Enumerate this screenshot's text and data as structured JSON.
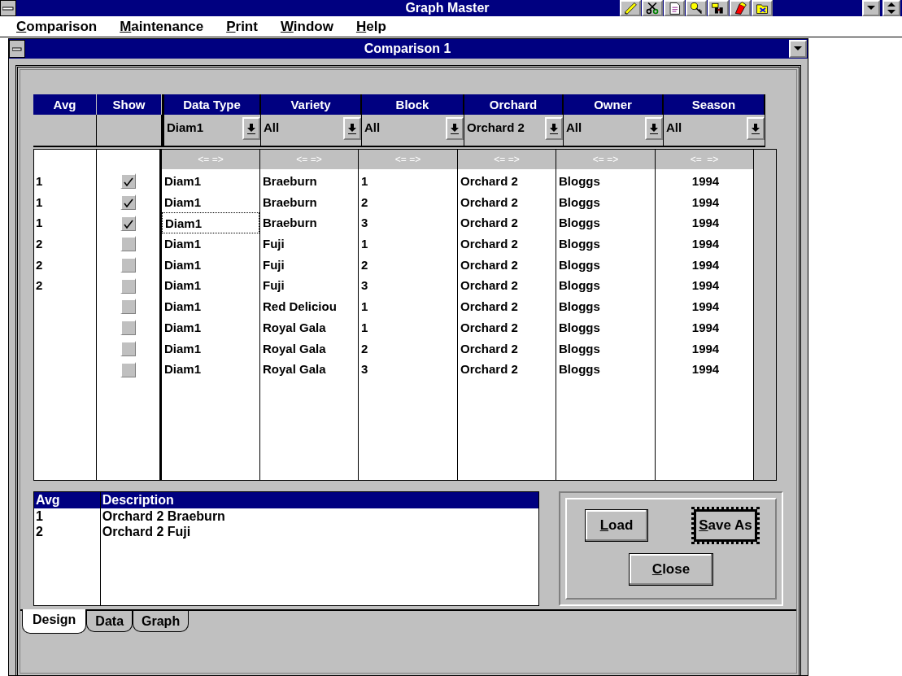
{
  "app_window": {
    "title": "Graph Master"
  },
  "menu_bar": [
    "Comparison",
    "Maintenance",
    "Print",
    "Window",
    "Help"
  ],
  "child_window": {
    "title": "Comparison 1"
  },
  "grid": {
    "fixed_columns": [
      "Avg",
      "Show"
    ],
    "columns": [
      {
        "header": "Data Type",
        "filter": "Diam1",
        "resize_hint": "<= =>"
      },
      {
        "header": "Variety",
        "filter": "All",
        "resize_hint": "<= =>"
      },
      {
        "header": "Block",
        "filter": "All",
        "resize_hint": "<= =>"
      },
      {
        "header": "Orchard",
        "filter": "Orchard 2",
        "resize_hint": "<= =>"
      },
      {
        "header": "Owner",
        "filter": "All",
        "resize_hint": "<= =>"
      },
      {
        "header": "Season",
        "filter": "All",
        "resize_hint": "<=  =>"
      }
    ],
    "rows": [
      {
        "avg": "1",
        "show": true,
        "focused": false,
        "cells": [
          "Diam1",
          "Braeburn",
          "1",
          "Orchard 2",
          "Bloggs",
          "1994"
        ]
      },
      {
        "avg": "1",
        "show": true,
        "focused": false,
        "cells": [
          "Diam1",
          "Braeburn",
          "2",
          "Orchard 2",
          "Bloggs",
          "1994"
        ]
      },
      {
        "avg": "1",
        "show": true,
        "focused": true,
        "cells": [
          "Diam1",
          "Braeburn",
          "3",
          "Orchard 2",
          "Bloggs",
          "1994"
        ]
      },
      {
        "avg": "2",
        "show": false,
        "focused": false,
        "cells": [
          "Diam1",
          "Fuji",
          "1",
          "Orchard 2",
          "Bloggs",
          "1994"
        ]
      },
      {
        "avg": "2",
        "show": false,
        "focused": false,
        "cells": [
          "Diam1",
          "Fuji",
          "2",
          "Orchard 2",
          "Bloggs",
          "1994"
        ]
      },
      {
        "avg": "2",
        "show": false,
        "focused": false,
        "cells": [
          "Diam1",
          "Fuji",
          "3",
          "Orchard 2",
          "Bloggs",
          "1994"
        ]
      },
      {
        "show": false,
        "focused": false,
        "cells": [
          "Diam1",
          "Red Deliciou",
          "1",
          "Orchard 2",
          "Bloggs",
          "1994"
        ]
      },
      {
        "show": false,
        "focused": false,
        "cells": [
          "Diam1",
          "Royal Gala",
          "1",
          "Orchard 2",
          "Bloggs",
          "1994"
        ]
      },
      {
        "show": false,
        "focused": false,
        "cells": [
          "Diam1",
          "Royal Gala",
          "2",
          "Orchard 2",
          "Bloggs",
          "1994"
        ]
      },
      {
        "show": false,
        "focused": false,
        "cells": [
          "Diam1",
          "Royal Gala",
          "3",
          "Orchard 2",
          "Bloggs",
          "1994"
        ]
      }
    ]
  },
  "description_list": {
    "columns": [
      "Avg",
      "Description"
    ],
    "rows": [
      {
        "avg": "1",
        "description": "Orchard 2 Braeburn"
      },
      {
        "avg": "2",
        "description": "Orchard 2 Fuji"
      }
    ]
  },
  "buttons": [
    {
      "label": "Load",
      "default": false
    },
    {
      "label": "Save As",
      "default": true
    },
    {
      "label": "Close",
      "default": false
    }
  ],
  "tabs": [
    {
      "label": "Design",
      "selected": true
    },
    {
      "label": "Data",
      "selected": false
    },
    {
      "label": "Graph",
      "selected": false
    }
  ]
}
